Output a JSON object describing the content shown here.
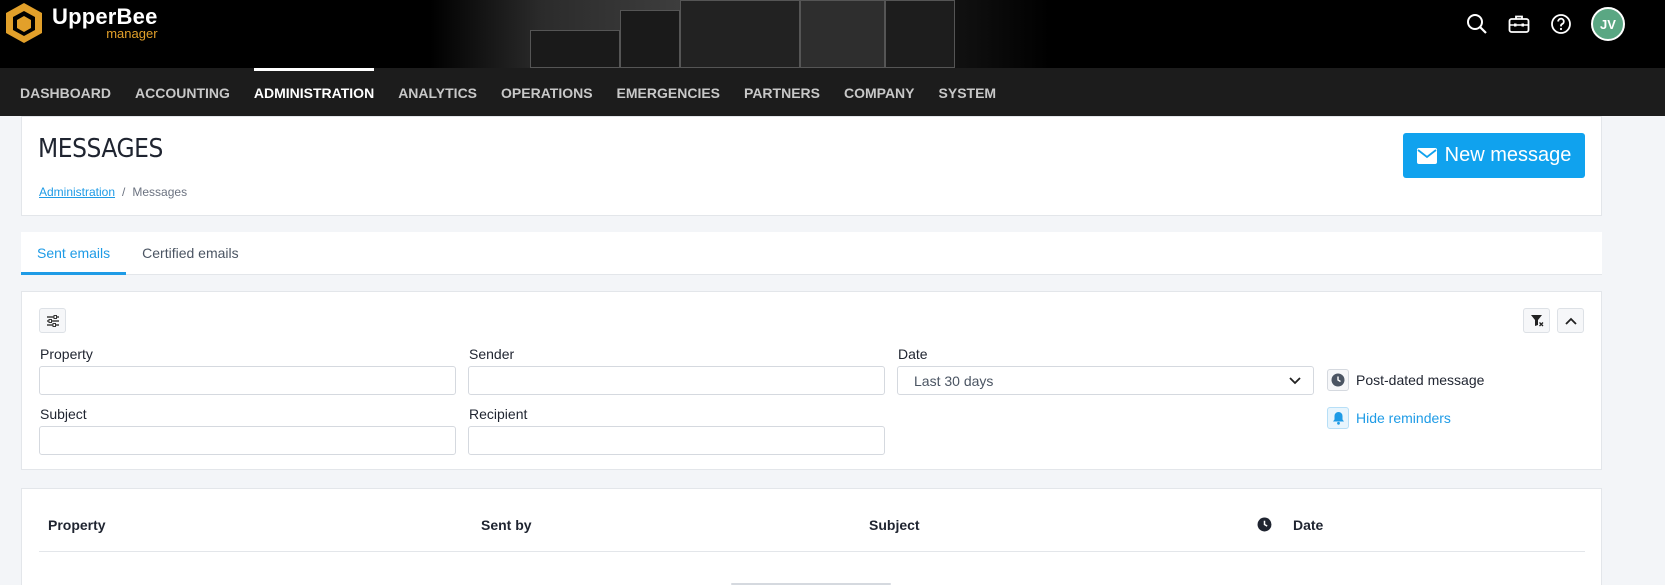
{
  "brand": {
    "name": "UpperBee",
    "sub": "manager",
    "accent": "#E2A02A"
  },
  "top_icons": [
    "search-icon",
    "toolbox-icon",
    "help-icon"
  ],
  "user": {
    "initials": "JV"
  },
  "nav": {
    "items": [
      {
        "label": "DASHBOARD"
      },
      {
        "label": "ACCOUNTING"
      },
      {
        "label": "ADMINISTRATION",
        "active": true
      },
      {
        "label": "ANALYTICS"
      },
      {
        "label": "OPERATIONS"
      },
      {
        "label": "EMERGENCIES"
      },
      {
        "label": "PARTNERS"
      },
      {
        "label": "COMPANY"
      },
      {
        "label": "SYSTEM"
      }
    ]
  },
  "page": {
    "title": "MESSAGES",
    "breadcrumb": {
      "parent": "Administration",
      "separator": "/",
      "current": "Messages"
    },
    "new_message_label": "New message"
  },
  "tabs": [
    {
      "label": "Sent emails",
      "active": true
    },
    {
      "label": "Certified emails"
    }
  ],
  "filters": {
    "property": {
      "label": "Property",
      "value": ""
    },
    "sender": {
      "label": "Sender",
      "value": ""
    },
    "date": {
      "label": "Date",
      "value": "Last 30 days"
    },
    "subject": {
      "label": "Subject",
      "value": ""
    },
    "recipient": {
      "label": "Recipient",
      "value": ""
    },
    "post_dated_label": "Post-dated message",
    "hide_reminders_label": "Hide reminders"
  },
  "table": {
    "columns": [
      "Property",
      "Sent by",
      "Subject",
      "Date"
    ]
  },
  "colors": {
    "primary": "#10A2EE",
    "link": "#1E9BE6",
    "nav_bg": "#1C1C1C",
    "topbar_bg": "#000000"
  }
}
